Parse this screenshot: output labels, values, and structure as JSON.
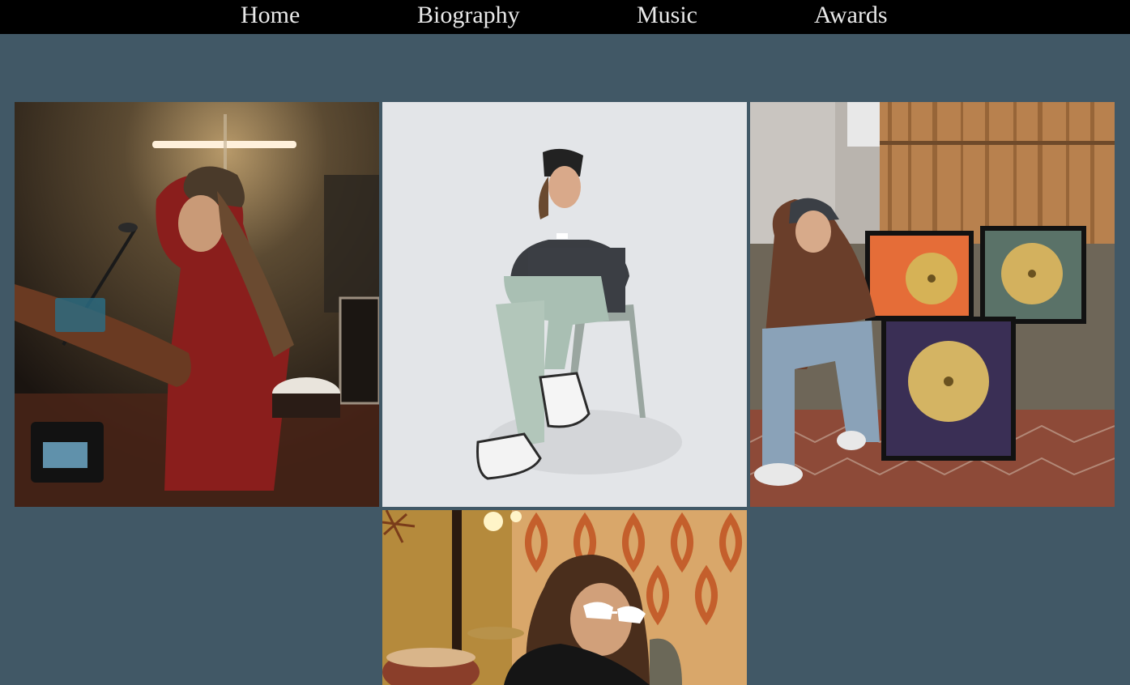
{
  "nav": {
    "items": [
      {
        "label": "Home"
      },
      {
        "label": "Biography"
      },
      {
        "label": "Music"
      },
      {
        "label": "Awards"
      }
    ]
  },
  "colors": {
    "page_background": "#415866",
    "navbar_background": "#000000",
    "nav_text": "#e9e9e9"
  },
  "gallery": {
    "photos": [
      {
        "depicts": "artist playing guitar in dim studio with headphones and microphone"
      },
      {
        "depicts": "artist seated on folding chair against light grey backdrop"
      },
      {
        "depicts": "artist seated beside framed gold record plaques"
      },
      {
        "depicts": "artist in white sunglasses in front of patterned wallpaper and drum kit"
      }
    ]
  }
}
